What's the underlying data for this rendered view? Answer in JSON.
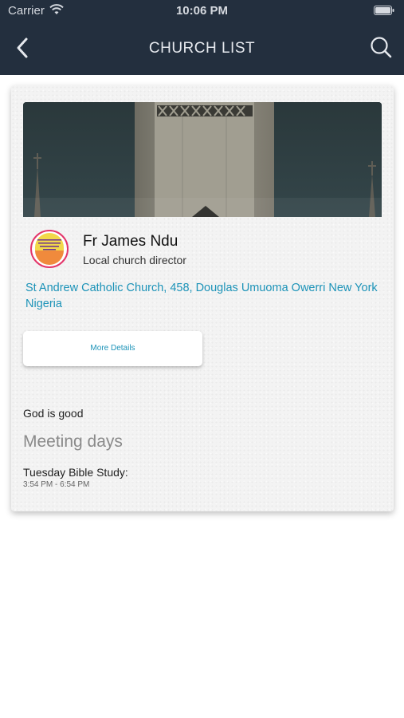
{
  "status_bar": {
    "carrier": "Carrier",
    "time": "10:06 PM"
  },
  "nav": {
    "title": "CHURCH LIST",
    "back_icon": "chevron-left-icon",
    "search_icon": "search-icon"
  },
  "church": {
    "pastor_name": "Fr James Ndu",
    "pastor_role": "Local church director",
    "address": "St Andrew Catholic Church, 458, Douglas Umuoma Owerri New York Nigeria",
    "details_button": "More Details",
    "motto": "God is good",
    "meeting_heading": "Meeting days",
    "meetings": [
      {
        "name": "Tuesday Bible Study:",
        "time": "3:54 PM - 6:54 PM"
      }
    ]
  },
  "colors": {
    "header": "#232f3e",
    "link": "#1c93b8",
    "avatar_border": "#e3356a"
  }
}
